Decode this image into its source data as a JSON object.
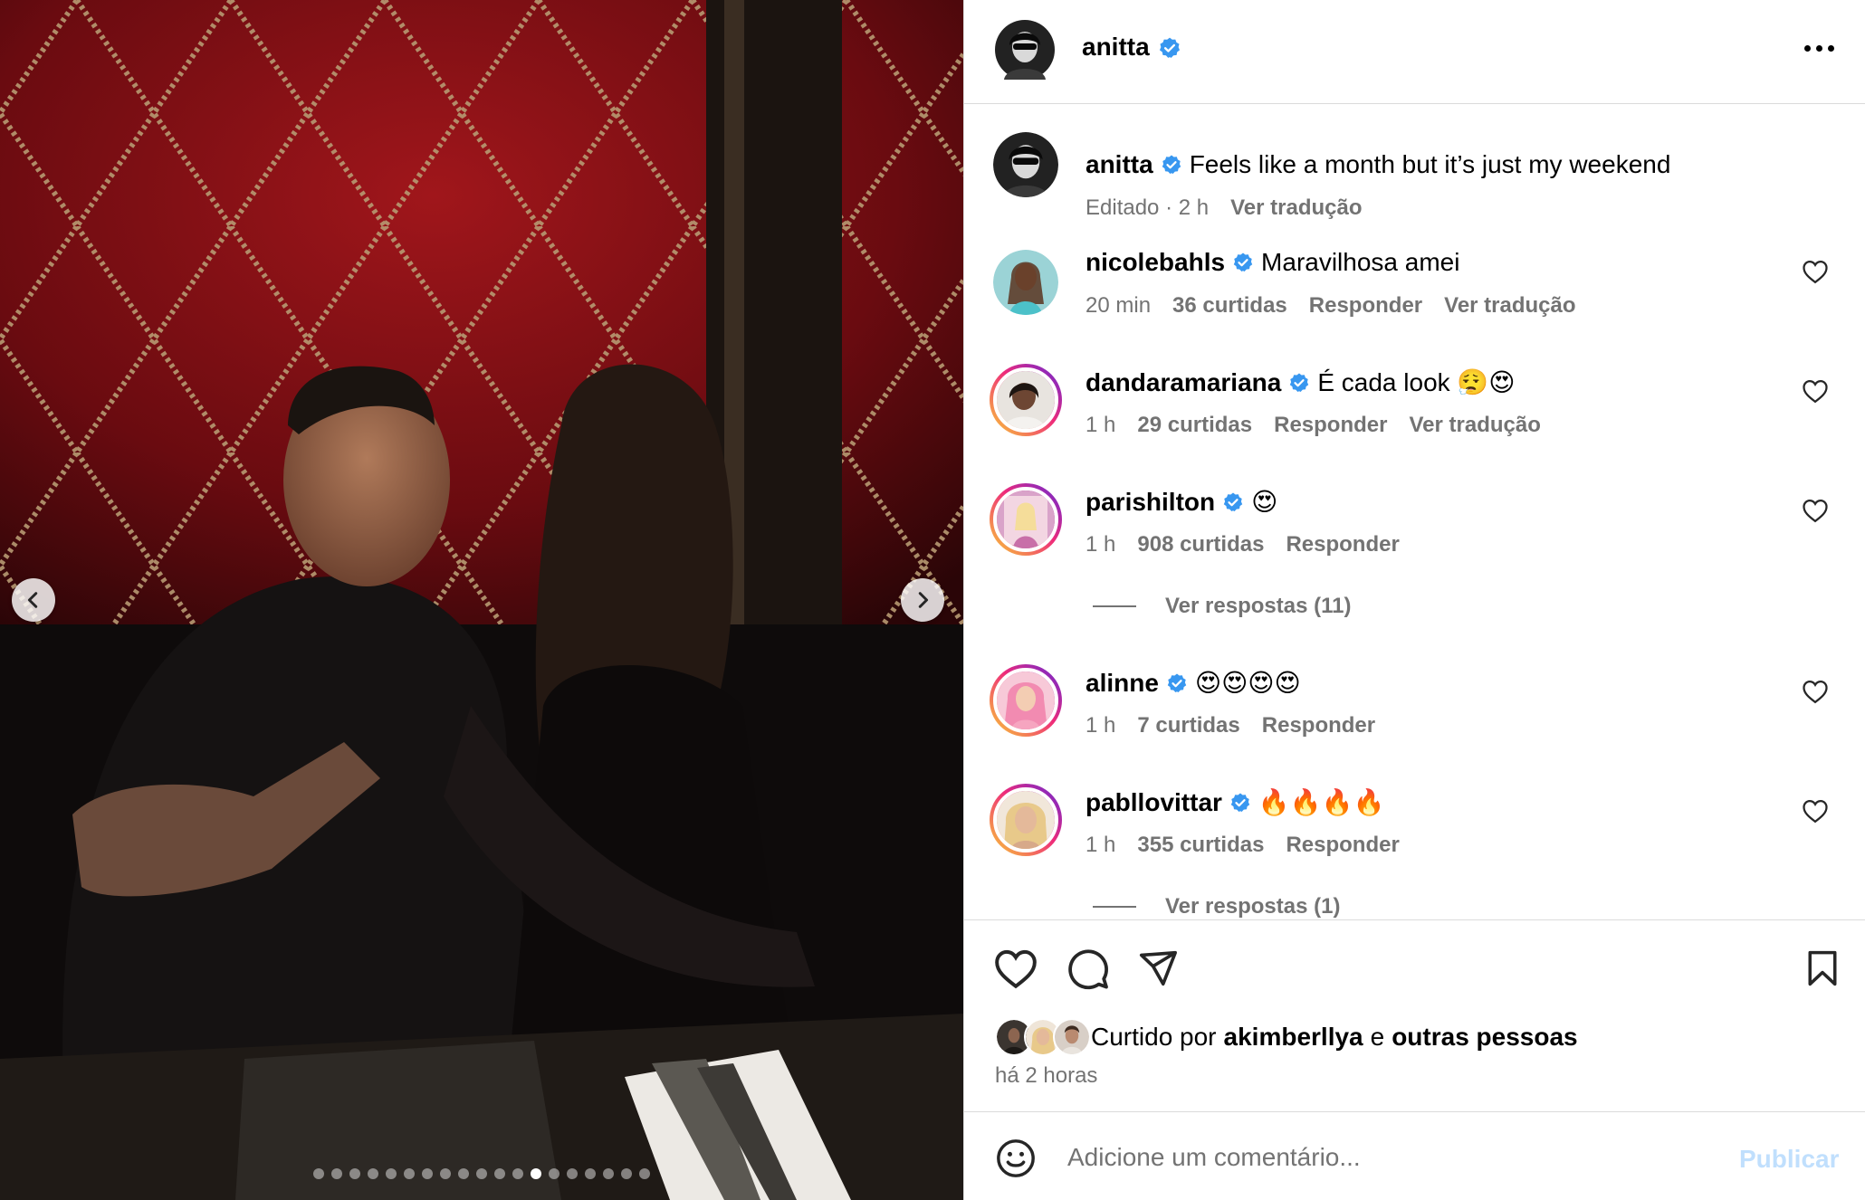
{
  "post": {
    "author": "anitta",
    "carousel_total": 19,
    "carousel_active": 12
  },
  "caption": {
    "user": "anitta",
    "text": "Feels like a month but it’s just my weekend",
    "edited": "Editado · 2 h",
    "translate": "Ver tradução"
  },
  "comments": [
    {
      "user": "nicolebahls",
      "text": "Maravilhosa amei",
      "time": "20 min",
      "likes": "36 curtidas",
      "reply": "Responder",
      "translate": "Ver tradução"
    },
    {
      "user": "dandaramariana",
      "text": "É cada look 😮‍💨😍",
      "time": "1 h",
      "likes": "29 curtidas",
      "reply": "Responder",
      "translate": "Ver tradução"
    },
    {
      "user": "parishilton",
      "text": "😍",
      "time": "1 h",
      "likes": "908 curtidas",
      "reply": "Responder",
      "view_replies": "Ver respostas (11)"
    },
    {
      "user": "alinne",
      "text": "😍😍😍😍",
      "time": "1 h",
      "likes": "7 curtidas",
      "reply": "Responder"
    },
    {
      "user": "pabllovittar",
      "text": "🔥🔥🔥🔥",
      "time": "1 h",
      "likes": "355 curtidas",
      "reply": "Responder",
      "view_replies": "Ver respostas (1)"
    }
  ],
  "likes": {
    "prefix": "Curtido por",
    "user": "akimberllya",
    "conj": "e",
    "others": "outras pessoas"
  },
  "time_ago": "há 2 horas",
  "add_comment": {
    "placeholder": "Adicione um comentário...",
    "publish": "Publicar"
  },
  "colors": {
    "verified": "#3897f0",
    "secondary_text": "#737373",
    "publish_disabled": "#c0dffd",
    "border": "#dbdbdb"
  }
}
